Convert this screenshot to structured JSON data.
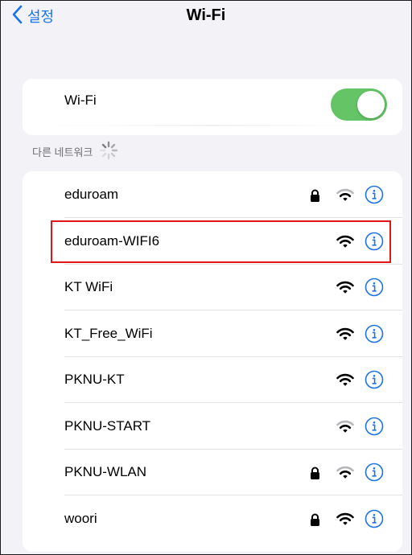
{
  "nav": {
    "back_label": "설정",
    "title": "Wi-Fi"
  },
  "wifi_toggle": {
    "label": "Wi-Fi",
    "enabled": true
  },
  "section": {
    "header": "다른 네트워크",
    "loading": true
  },
  "networks": [
    {
      "name": "eduroam",
      "locked": true,
      "signal": "medium",
      "selected": false
    },
    {
      "name": "eduroam-WIFI6",
      "locked": false,
      "signal": "full",
      "selected": true
    },
    {
      "name": "KT WiFi",
      "locked": false,
      "signal": "full",
      "selected": false
    },
    {
      "name": "KT_Free_WiFi",
      "locked": false,
      "signal": "full",
      "selected": false
    },
    {
      "name": "PKNU-KT",
      "locked": false,
      "signal": "full",
      "selected": false
    },
    {
      "name": "PKNU-START",
      "locked": false,
      "signal": "medium",
      "selected": false
    },
    {
      "name": "PKNU-WLAN",
      "locked": true,
      "signal": "medium",
      "selected": false
    },
    {
      "name": "woori",
      "locked": true,
      "signal": "full",
      "selected": false
    }
  ],
  "colors": {
    "accent": "#1a73e8",
    "toggle_on": "#64c466",
    "highlight": "#e1151a",
    "background": "#f2f2f7"
  },
  "icons": {
    "back": "chevron-left-icon",
    "lock": "lock-icon",
    "wifi": "wifi-icon",
    "info": "info-icon",
    "spinner": "spinner-icon"
  }
}
